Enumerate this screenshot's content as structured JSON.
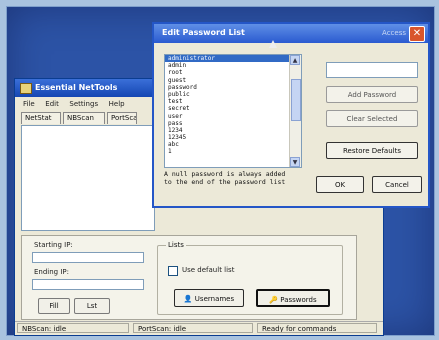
{
  "back_window": {
    "title": "Essential NetTools",
    "menu": [
      "File",
      "Edit",
      "Settings",
      "Help"
    ],
    "tabs": [
      "NetStat",
      "NBScan",
      "PortScan"
    ],
    "starting_ip_label": "Starting IP:",
    "ending_ip_label": "Ending IP:",
    "fill_button": "Fill",
    "list_button": "Lst",
    "group_title": "Lists",
    "checkbox_label": "Use default list",
    "usernames_button": "Usernames",
    "passwords_button": "Passwords",
    "status": [
      "NBScan: idle",
      "PortScan: idle",
      "Ready for commands"
    ]
  },
  "dialog": {
    "title": "Edit Password List",
    "hint": "Access",
    "close_glyph": "✕",
    "passwords": [
      "administrator",
      "admin",
      "root",
      "guest",
      "password",
      "public",
      "test",
      "secret",
      "user",
      "pass",
      "1234",
      "12345",
      "abc",
      "1"
    ],
    "selected_index": 0,
    "new_password_value": "",
    "add_button": "Add Password",
    "clear_button": "Clear Selected",
    "restore_button": "Restore Defaults",
    "info_text": "A null password is always added to the end of the password list",
    "ok_button": "OK",
    "cancel_button": "Cancel"
  },
  "colors": {
    "desktop": "#2c53a6",
    "titlebar": "#2a5ad0",
    "selection": "#316ac5"
  }
}
